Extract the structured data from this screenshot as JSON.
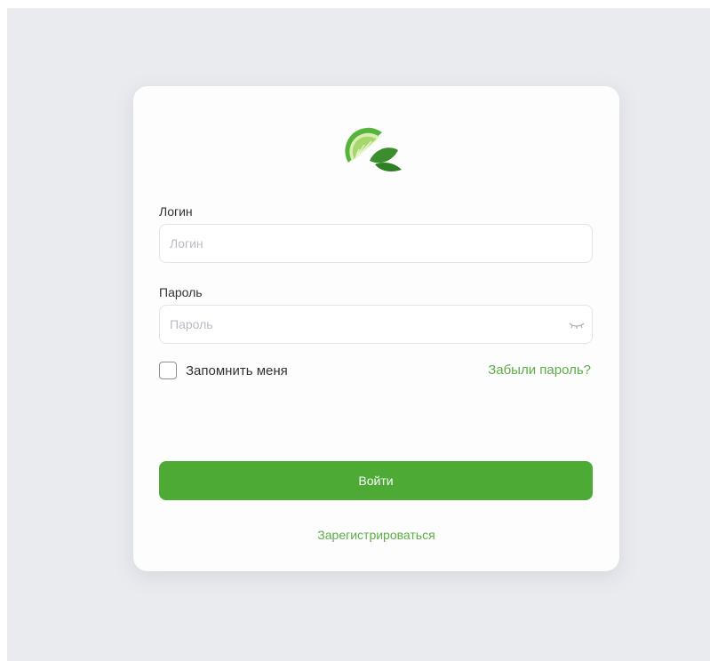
{
  "login_form": {
    "logo_icon": "lime-slice-logo",
    "login_label": "Логин",
    "login_placeholder": "Логин",
    "password_label": "Пароль",
    "password_placeholder": "Пароль",
    "password_toggle_icon": "eye-slash-icon",
    "remember_label": "Запомнить меня",
    "remember_checked": false,
    "forgot_link": "Забыли пароль?",
    "submit_label": "Войти",
    "register_link": "Зарегистрироваться"
  },
  "colors": {
    "background": "#e9ebef",
    "card": "#fdfdfd",
    "primary_green": "#4caa35",
    "link_green": "#5cad46"
  }
}
